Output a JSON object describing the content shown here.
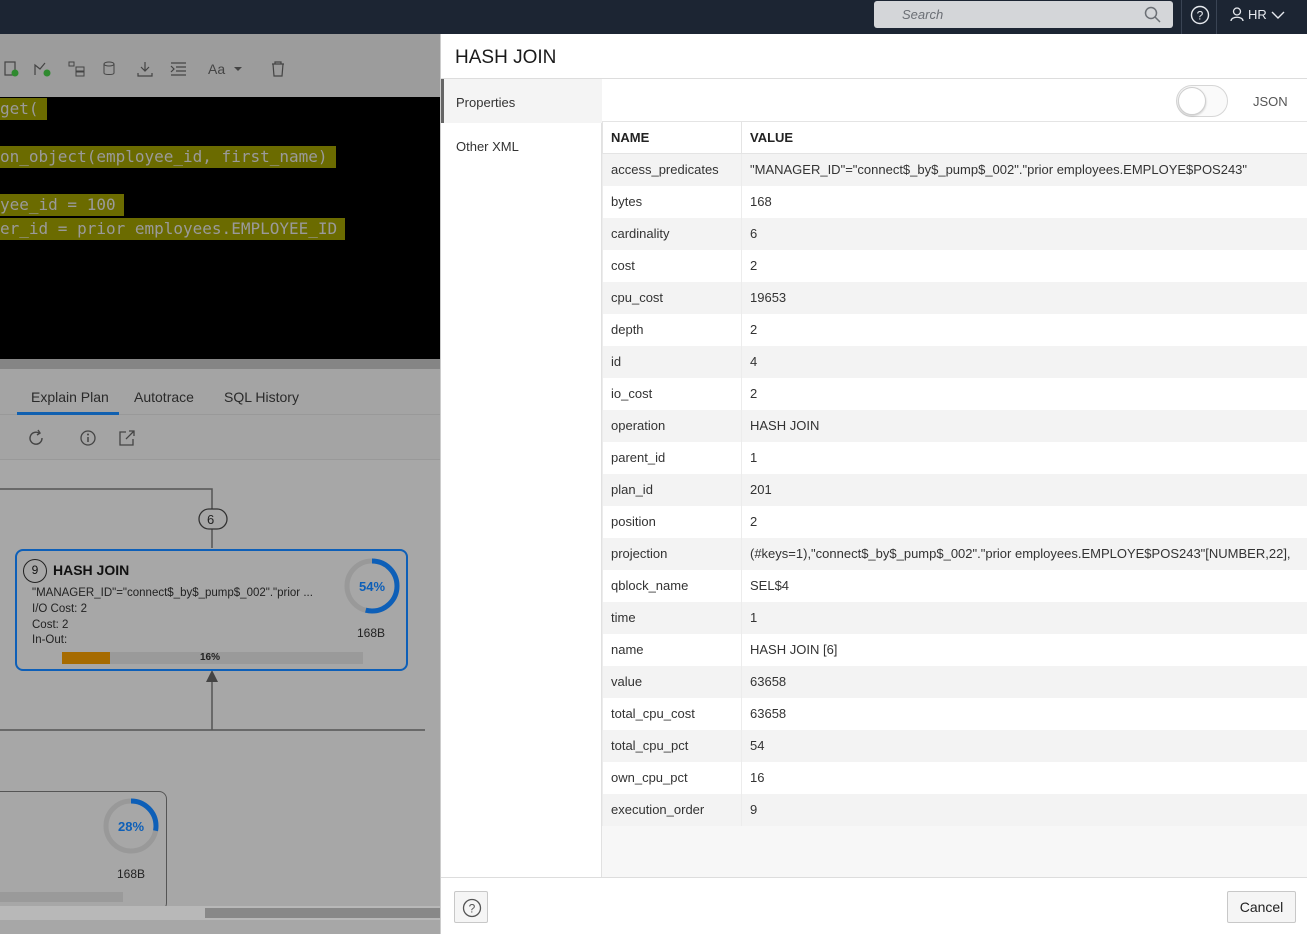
{
  "topbar": {
    "search_placeholder": "Search",
    "user": "HR"
  },
  "worksheet": {
    "code_lines": [
      "get(",
      "on_object(employee_id, first_name)",
      "yee_id = 100",
      "er_id = prior employees.EMPLOYEE_ID"
    ],
    "tabs": [
      "Explain Plan",
      "Autotrace",
      "SQL History"
    ],
    "plan": {
      "connector_label": "6",
      "node": {
        "number": "9",
        "title": "HASH JOIN",
        "predicate": "\"MANAGER_ID\"=\"connect$_by$_pump$_002\".\"prior ...",
        "io_cost": "I/O Cost: 2",
        "cost": "Cost: 2",
        "in_out": "In-Out:",
        "cpu_pct": 54,
        "cpu_pct_label": "54%",
        "bytes_label": "168B",
        "own_pct": 16,
        "own_pct_label": "16%"
      },
      "node2": {
        "cpu_pct": 28,
        "cpu_pct_label": "28%",
        "bytes_label": "168B"
      }
    }
  },
  "dialog": {
    "title": "HASH JOIN",
    "sidebar": [
      "Properties",
      "Other XML"
    ],
    "json_label": "JSON",
    "columns": [
      "NAME",
      "VALUE"
    ],
    "rows": [
      [
        "access_predicates",
        "\"MANAGER_ID\"=\"connect$_by$_pump$_002\".\"prior employees.EMPLOYE$POS243\""
      ],
      [
        "bytes",
        "168"
      ],
      [
        "cardinality",
        "6"
      ],
      [
        "cost",
        "2"
      ],
      [
        "cpu_cost",
        "19653"
      ],
      [
        "depth",
        "2"
      ],
      [
        "id",
        "4"
      ],
      [
        "io_cost",
        "2"
      ],
      [
        "operation",
        "HASH JOIN"
      ],
      [
        "parent_id",
        "1"
      ],
      [
        "plan_id",
        "201"
      ],
      [
        "position",
        "2"
      ],
      [
        "projection",
        "(#keys=1),\"connect$_by$_pump$_002\".\"prior employees.EMPLOYE$POS243\"[NUMBER,22],"
      ],
      [
        "qblock_name",
        "SEL$4"
      ],
      [
        "time",
        "1"
      ],
      [
        "name",
        "HASH JOIN [6]"
      ],
      [
        "value",
        "63658"
      ],
      [
        "total_cpu_cost",
        "63658"
      ],
      [
        "total_cpu_pct",
        "54"
      ],
      [
        "own_cpu_pct",
        "16"
      ],
      [
        "execution_order",
        "9"
      ]
    ],
    "cancel_label": "Cancel"
  }
}
